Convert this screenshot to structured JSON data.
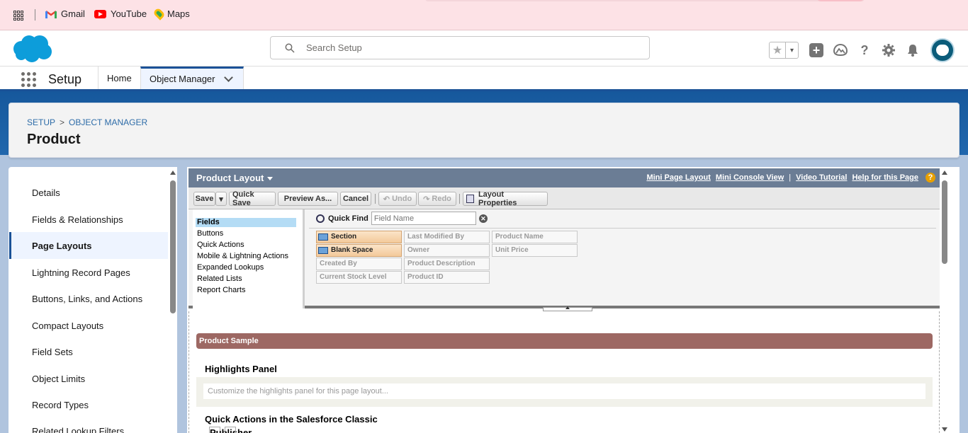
{
  "bookmarks": [
    {
      "label": "Gmail",
      "icon": "gmail-icon"
    },
    {
      "label": "YouTube",
      "icon": "youtube-icon"
    },
    {
      "label": "Maps",
      "icon": "maps-icon"
    }
  ],
  "header": {
    "search_placeholder": "Search Setup"
  },
  "nav": {
    "title": "Setup",
    "tabs": [
      {
        "label": "Home"
      },
      {
        "label": "Object Manager"
      }
    ]
  },
  "page": {
    "breadcrumb": [
      "SETUP",
      "OBJECT MANAGER"
    ],
    "breadcrumb_sep": ">",
    "title": "Product"
  },
  "sidebar": {
    "items": [
      {
        "label": "Details"
      },
      {
        "label": "Fields & Relationships"
      },
      {
        "label": "Page Layouts",
        "active": true
      },
      {
        "label": "Lightning Record Pages"
      },
      {
        "label": "Buttons, Links, and Actions"
      },
      {
        "label": "Compact Layouts"
      },
      {
        "label": "Field Sets"
      },
      {
        "label": "Object Limits"
      },
      {
        "label": "Record Types"
      },
      {
        "label": "Related Lookup Filters"
      }
    ]
  },
  "layout": {
    "title": "Product Layout",
    "links": [
      "Mini Page Layout",
      "Mini Console View",
      "Video Tutorial",
      "Help for this Page"
    ],
    "link_sep": "|",
    "toolbar": {
      "save": "Save",
      "quick_save": "Quick Save",
      "preview": "Preview As...",
      "cancel": "Cancel",
      "undo": "Undo",
      "redo": "Redo",
      "properties": "Layout Properties"
    },
    "categories": [
      "Fields",
      "Buttons",
      "Quick Actions",
      "Mobile & Lightning Actions",
      "Expanded Lookups",
      "Related Lists",
      "Report Charts"
    ],
    "quick_find_label": "Quick Find",
    "quick_find_placeholder": "Field Name",
    "fields": [
      "Section",
      "Blank Space",
      "Created By",
      "Current Stock Level",
      "Last Modified By",
      "Owner",
      "Product Description",
      "Product ID",
      "Product Name",
      "Unit Price"
    ],
    "sample_title": "Product Sample",
    "highlights_title": "Highlights Panel",
    "highlights_hint": "Customize the highlights panel for this page layout...",
    "quick_actions_title": "Quick Actions in the Salesforce Classic",
    "publisher_label": "Publisher"
  },
  "colors": {
    "accent": "#1b5297",
    "layout_bar": "#6b7d95",
    "sample_bar": "#9d6863"
  }
}
